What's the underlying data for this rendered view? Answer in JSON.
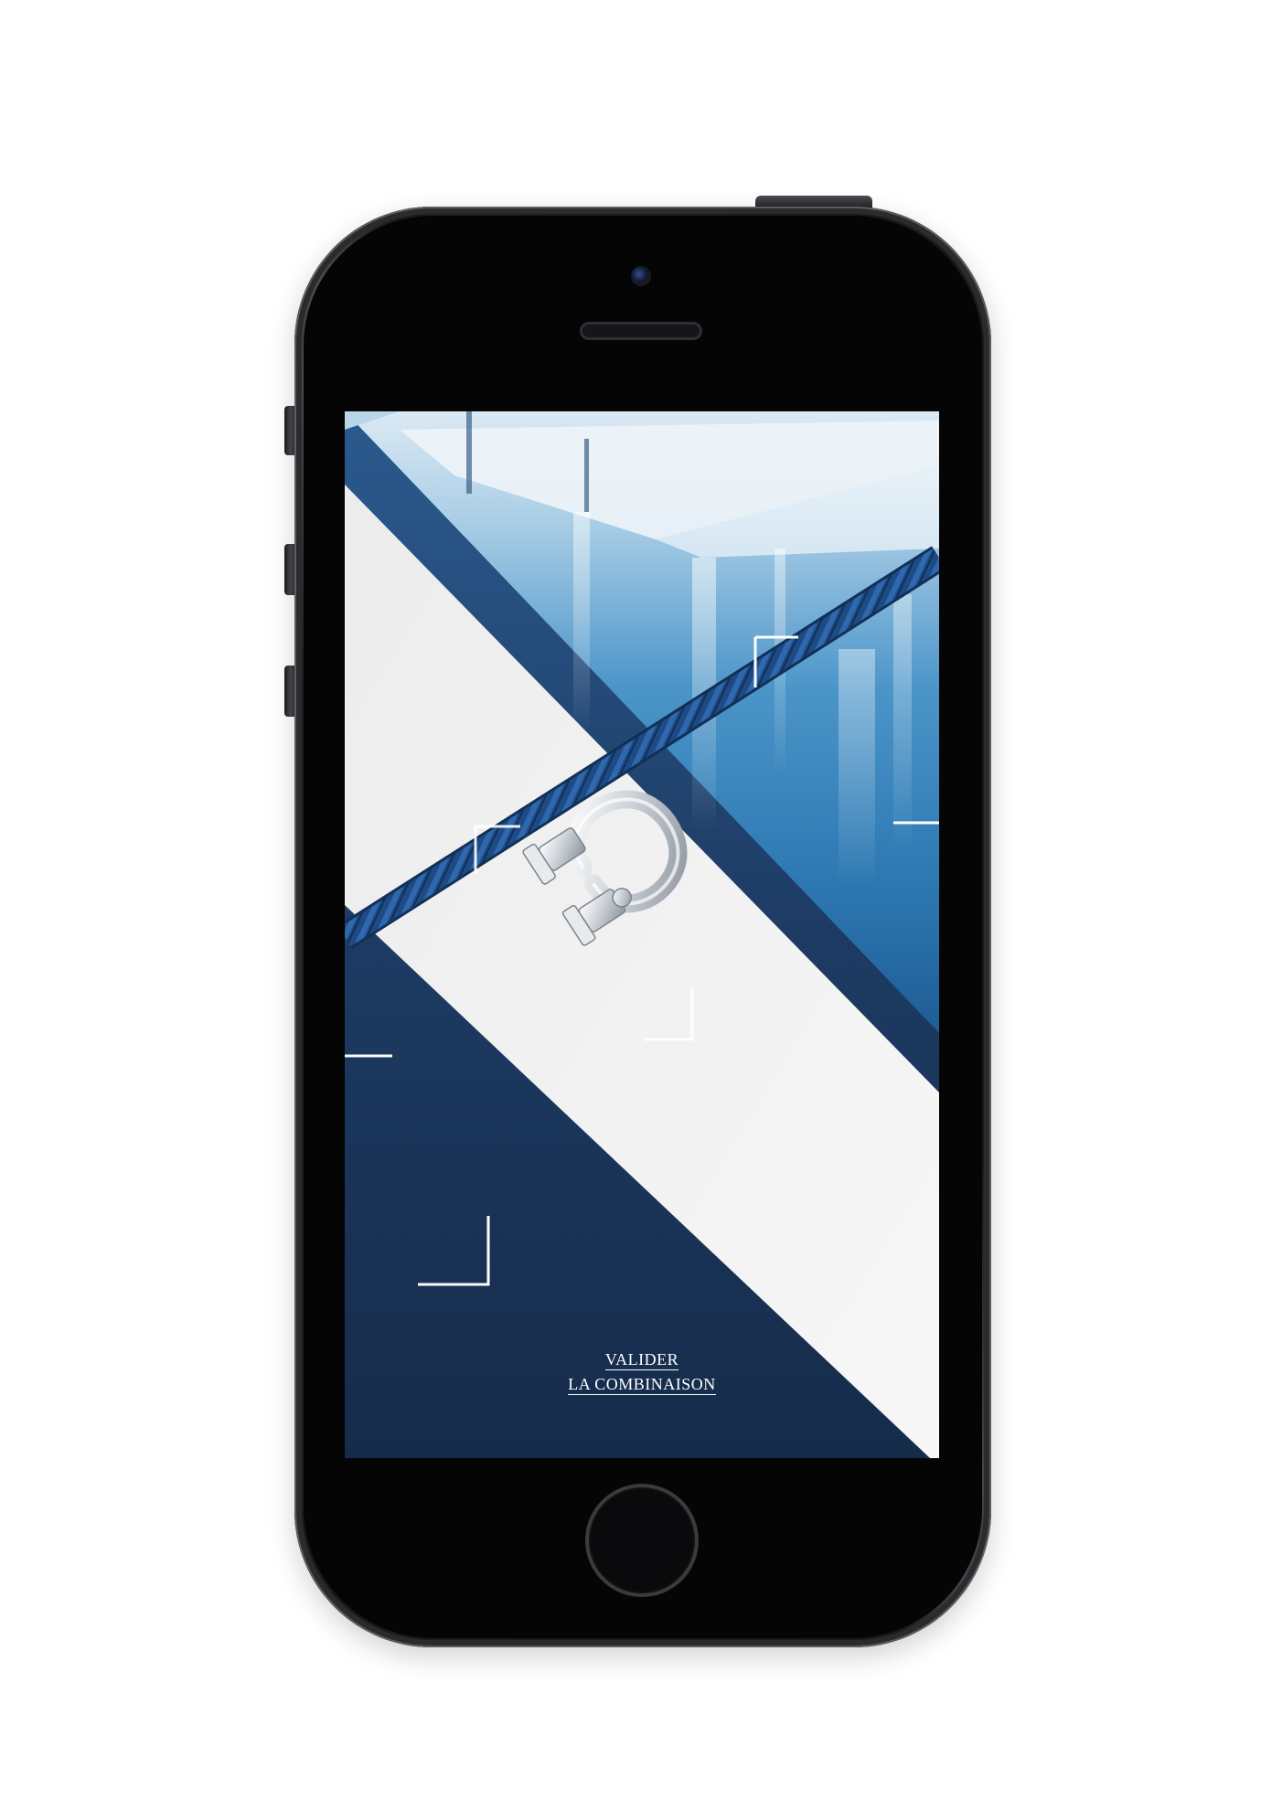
{
  "device": {
    "model_icon": "smartphone-icon",
    "frame_color": "#1c1c1f",
    "screen_color": "#050506"
  },
  "screen": {
    "scene": {
      "sky_color": "#d8e7f2",
      "water_color": "#3f8cc4",
      "paper_color": "#f2f2f2",
      "navy_color": "#1b3354",
      "rope_color": "#1d4b86",
      "clasp_color": "#d9dde2",
      "bracket_color": "#ffffff",
      "clasp_icon": "horseshoe-clasp-icon"
    },
    "cta": {
      "line1": "VALIDER",
      "line2": "LA COMBINAISON"
    }
  }
}
